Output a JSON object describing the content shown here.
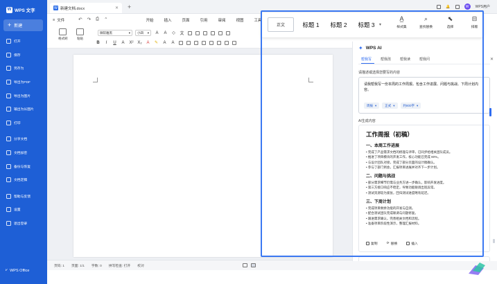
{
  "app": {
    "name": "WPS 文字",
    "footer": "WPS Office"
  },
  "sidebar": {
    "new_label": "新建",
    "items": [
      {
        "label": "打开",
        "icon": "folder-icon"
      },
      {
        "label": "保存",
        "icon": "save-icon"
      },
      {
        "label": "另存为",
        "icon": "save-as-icon"
      },
      {
        "label": "导出为PDF",
        "icon": "pdf-icon"
      },
      {
        "label": "导出为图片",
        "icon": "image-icon"
      },
      {
        "label": "输出为长图片",
        "icon": "long-image-icon"
      },
      {
        "label": "打印",
        "icon": "print-icon"
      },
      {
        "label": "分享文档",
        "icon": "share-icon"
      },
      {
        "label": "文档加密",
        "icon": "lock-icon"
      },
      {
        "label": "备份与恢复",
        "icon": "backup-icon"
      },
      {
        "label": "文档定稿",
        "icon": "finalize-icon"
      },
      {
        "label": "帮助与反馈",
        "icon": "help-icon"
      },
      {
        "label": "设置",
        "icon": "gear-icon"
      },
      {
        "label": "退出登录",
        "icon": "logout-icon"
      }
    ]
  },
  "titlebar": {
    "doc_tab": "新建文档.docx",
    "user": "WPS用户"
  },
  "menubar": {
    "file": "文件",
    "items": [
      "开始",
      "插入",
      "页面",
      "引用",
      "审阅",
      "视图",
      "工具"
    ]
  },
  "ribbon": {
    "font_name": "微软雅黑",
    "font_size": "小四",
    "copy_label": "格式刷",
    "paste_label": "粘贴"
  },
  "style_popup": {
    "normal": "正文",
    "headings": [
      "标题 1",
      "标题 2",
      "标题 3"
    ],
    "tools": [
      "样式集",
      "查找替换",
      "选择",
      "排版"
    ]
  },
  "status": {
    "page_count": "页码: 1",
    "pages": "页面: 1/1",
    "words": "字数: 0",
    "spell": "拼写检查: 打开",
    "proof": "校对"
  },
  "ai": {
    "title": "WPS AI",
    "tabs": [
      "帮我写",
      "帮我改",
      "帮我读",
      "帮我问"
    ],
    "active_tab": "帮我写",
    "prompt_label": "请描述或选择您要写的内容",
    "prompt_text": "请我帮我写一份本周的工作周报。包含工作进展、问题与挑战、下周计划内容。",
    "chips": [
      "周报",
      "正式",
      "约800字"
    ],
    "result_label": "AI生成内容",
    "result": {
      "title": "工作周报（初稿）",
      "sections": [
        {
          "heading": "一、本周工作进展",
          "lines": [
            "• 完成了产品需求文档的梳理与评审，已同步给相关团队成员。",
            "• 推进了项目模块的开发工作，核心功能已完成 80%。",
            "• 与设计团队对接，完成了部分页面的设计稿确认。",
            "• 参与了部门例会，汇报项目进展并对齐下一步计划。"
          ]
        },
        {
          "heading": "二、问题与挑战",
          "lines": [
            "• 部分需求细节仍需与业务方进一步确认，影响开发进度。",
            "• 第三方接口响应不稳定，导致功能联调出现异常。",
            "• 测试资源较为紧张，回归测试进度略有延迟。"
          ]
        },
        {
          "heading": "三、下周计划",
          "lines": [
            "• 完成项目剩余功能的开发与自测。",
            "• 配合测试团队完成联调与问题修复。",
            "• 跟进需求确认，完善相关文档和流程。",
            "• 准备项目阶段性演示，整理汇报材料。"
          ]
        }
      ],
      "actions": [
        "复制",
        "替换",
        "插入"
      ]
    }
  },
  "colors": {
    "sidebar": "#1e5fd6",
    "accent": "#2f6cf0",
    "highlight": "#3a78f2"
  }
}
